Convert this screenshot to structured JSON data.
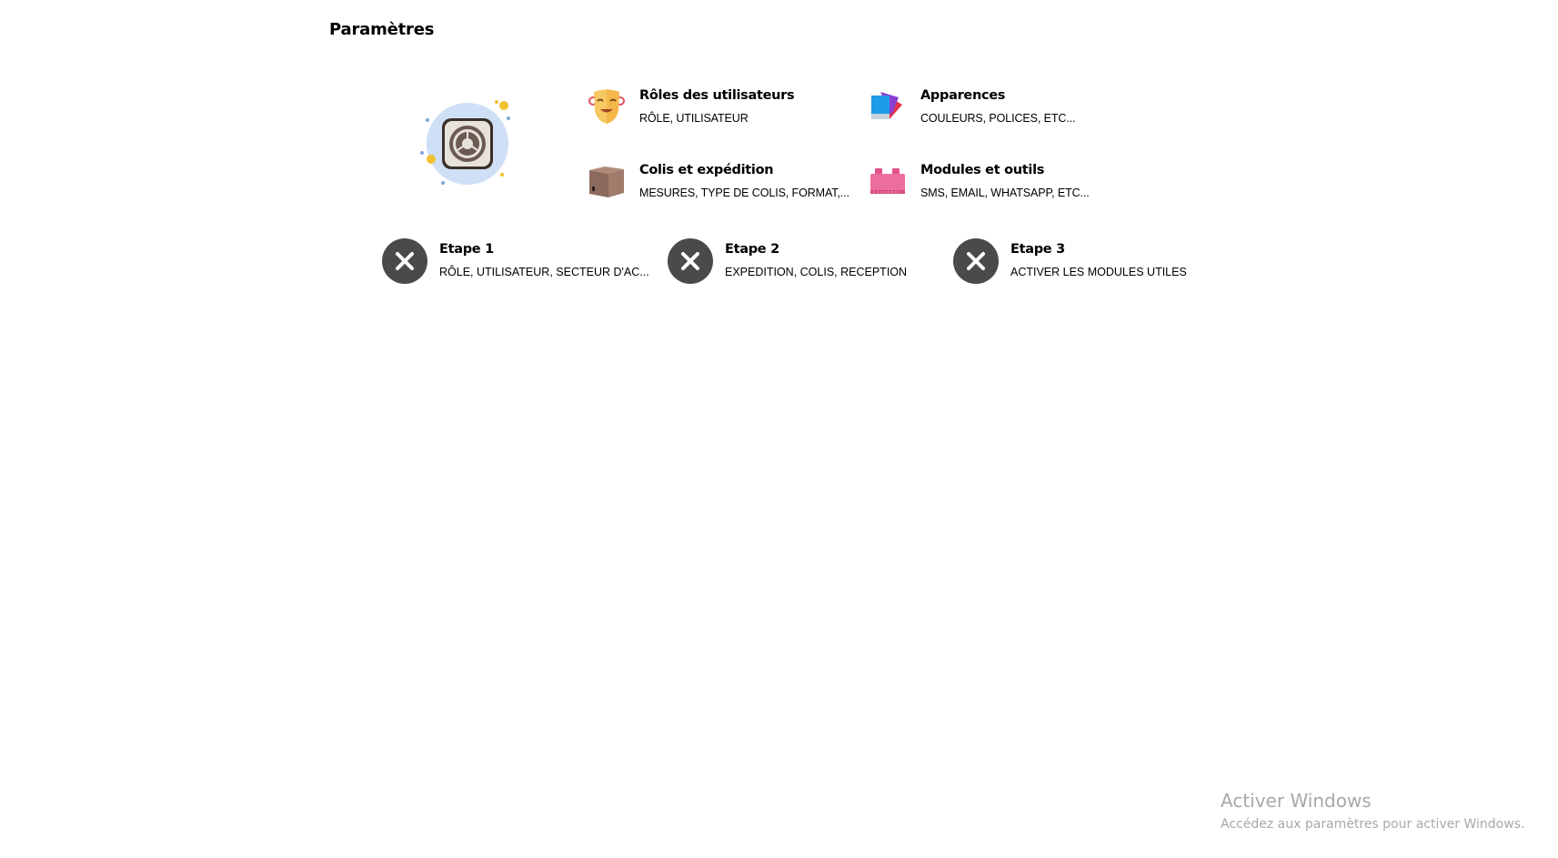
{
  "header": {
    "title": "Paramètres"
  },
  "settings": [
    {
      "key": "roles",
      "title": "Rôles des utilisateurs",
      "subtitle": "RÔLE, UTILISATEUR",
      "icon": "theater-mask-icon"
    },
    {
      "key": "appearance",
      "title": "Apparences",
      "subtitle": "COULEURS, POLICES, ETC...",
      "icon": "color-swatch-icon"
    },
    {
      "key": "shipping",
      "title": "Colis et expédition",
      "subtitle": "MESURES, TYPE DE COLIS, FORMAT,...",
      "icon": "package-box-icon"
    },
    {
      "key": "modules",
      "title": "Modules et outils",
      "subtitle": "SMS, EMAIL, WHATSAPP, ETC...",
      "icon": "building-block-icon"
    }
  ],
  "steps": [
    {
      "title": "Etape 1",
      "subtitle": "RÔLE, UTILISATEUR, SECTEUR D'AC...",
      "status": "incomplete"
    },
    {
      "title": "Etape 2",
      "subtitle": "EXPEDITION, COLIS, RECEPTION",
      "status": "incomplete"
    },
    {
      "title": "Etape 3",
      "subtitle": "ACTIVER LES MODULES UTILES",
      "status": "incomplete"
    }
  ],
  "watermark": {
    "line1": "Activer Windows",
    "line2": "Accédez aux paramètres pour activer Windows."
  },
  "colors": {
    "step_circle": "#4a4a4a",
    "hero_bg": "#cfe0f6",
    "watermark": "#a8a8a8"
  }
}
